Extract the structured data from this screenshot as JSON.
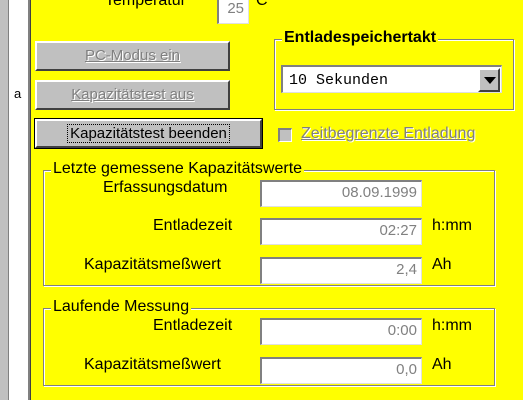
{
  "left_fragment": "a",
  "temperature": {
    "label": "Temperatur",
    "value": "25",
    "unit": "C"
  },
  "buttons": {
    "pc_mode": "PC-Modus ein",
    "capacity_test_off": "Kapazitätstest aus",
    "capacity_test_end": "Kapazitätstest beenden"
  },
  "discharge_clock": {
    "title": "Entladespeichertakt",
    "selected": "10 Sekunden"
  },
  "timed_discharge": {
    "label": "Zeitbegrenzte Entladung",
    "checked": false
  },
  "last_measured": {
    "title": "Letzte gemessene Kapazitätswerte",
    "date_label": "Erfassungsdatum",
    "date_value": "08.09.1999",
    "discharge_time_label": "Entladezeit",
    "discharge_time_value": "02:27",
    "discharge_time_unit": "h:mm",
    "capacity_label": "Kapazitätsmeßwert",
    "capacity_value": "2,4",
    "capacity_unit": "Ah"
  },
  "running": {
    "title": "Laufende Messung",
    "discharge_time_label": "Entladezeit",
    "discharge_time_value": "0:00",
    "discharge_time_unit": "h:mm",
    "capacity_label": "Kapazitätsmeßwert",
    "capacity_value": "0,0",
    "capacity_unit": "Ah"
  },
  "colors": {
    "panel_background": "#ffff00",
    "button_face": "#c0c0c0",
    "disabled_text": "#808080"
  }
}
